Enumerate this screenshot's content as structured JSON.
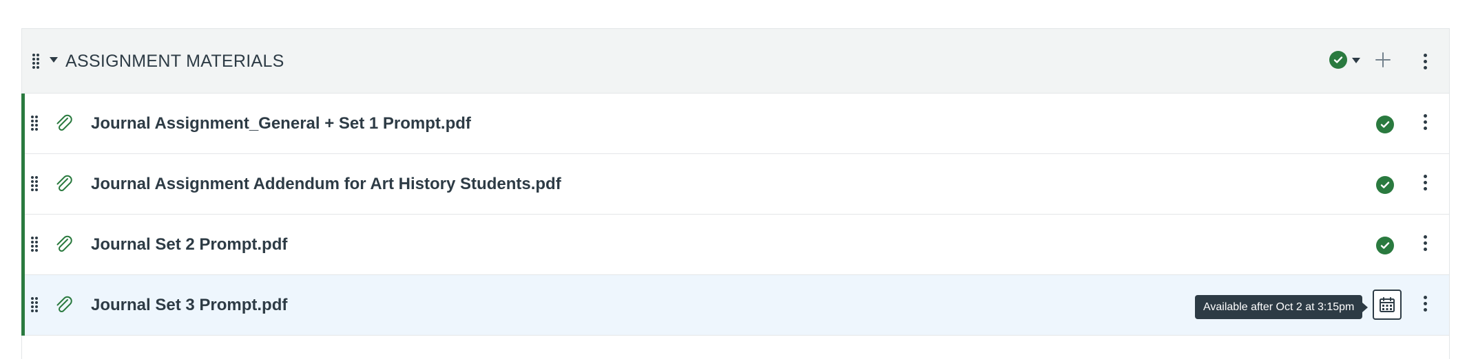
{
  "module": {
    "title": "ASSIGNMENT MATERIALS",
    "status": "published"
  },
  "items": [
    {
      "title": "Journal Assignment_General + Set 1 Prompt.pdf",
      "status": "published",
      "icon": "paperclip-icon"
    },
    {
      "title": "Journal Assignment Addendum for Art History Students.pdf",
      "status": "published",
      "icon": "paperclip-icon"
    },
    {
      "title": "Journal Set 2 Prompt.pdf",
      "status": "published",
      "icon": "paperclip-icon"
    },
    {
      "title": "Journal Set 3 Prompt.pdf",
      "status": "scheduled",
      "icon": "paperclip-icon",
      "tooltip": "Available after Oct 2 at 3:15pm"
    }
  ],
  "colors": {
    "published_green": "#2a7a3f",
    "text": "#2d3b45",
    "header_bg": "#f2f4f4",
    "highlight_bg": "#eef6fd"
  }
}
